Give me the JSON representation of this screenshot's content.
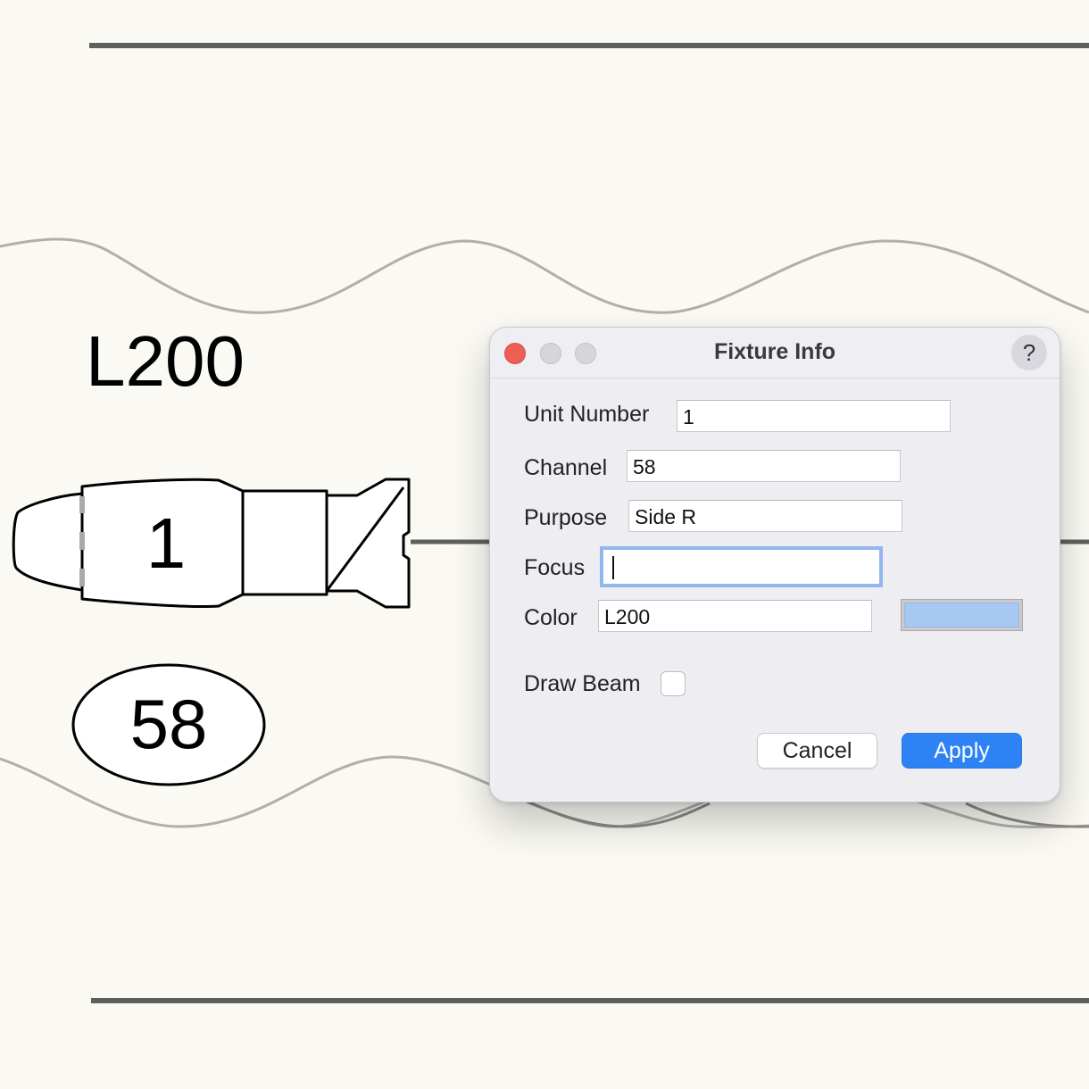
{
  "drawing": {
    "color_label": "L200",
    "unit_number": "1",
    "channel": "58"
  },
  "dialog": {
    "title": "Fixture Info",
    "help_label": "?",
    "fields": {
      "unit_number": {
        "label": "Unit Number",
        "value": "1"
      },
      "channel": {
        "label": "Channel",
        "value": "58"
      },
      "purpose": {
        "label": "Purpose",
        "value": "Side R"
      },
      "focus": {
        "label": "Focus",
        "value": ""
      },
      "color": {
        "label": "Color",
        "value": "L200",
        "swatch": "#a8c8f4"
      }
    },
    "draw_beam": {
      "label": "Draw Beam",
      "checked": false
    },
    "cancel_label": "Cancel",
    "apply_label": "Apply"
  },
  "colors": {
    "accent": "#2d82f5",
    "focus_ring": "#91b6f0",
    "close": "#ee5e55",
    "background": "#faf9f3"
  },
  "icons": {
    "help": "question-mark-icon",
    "fixture": "ellipsoidal-fixture-icon"
  }
}
